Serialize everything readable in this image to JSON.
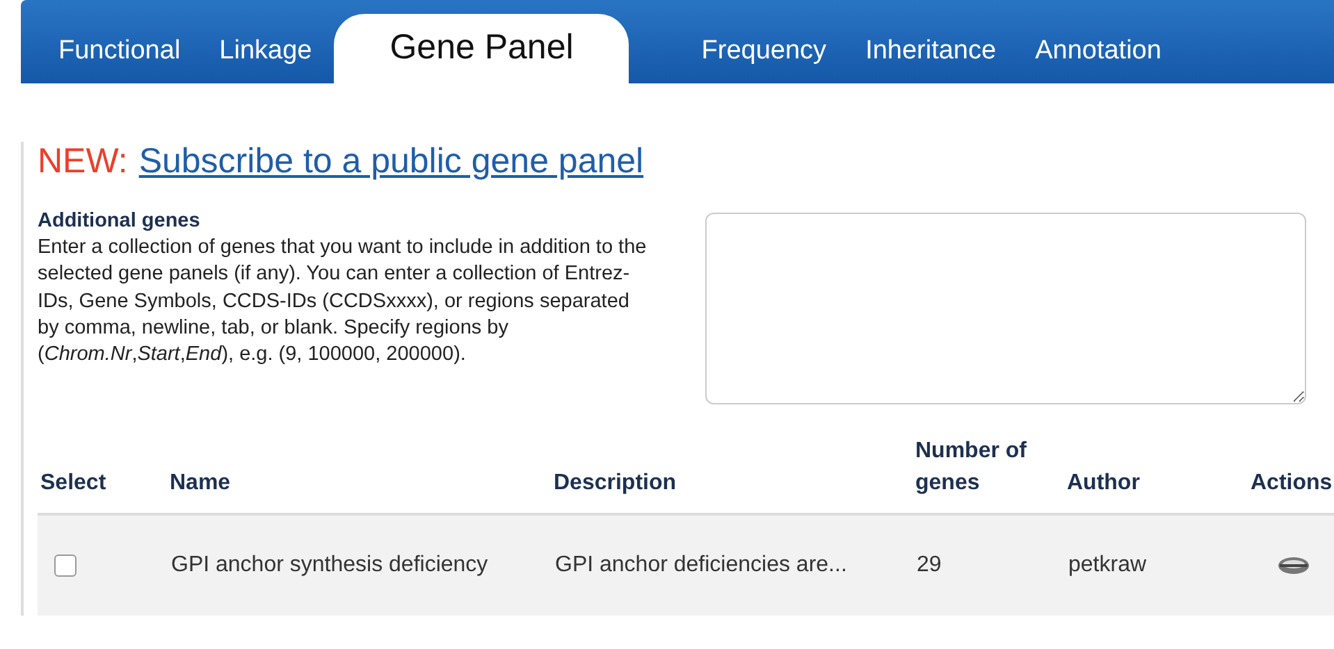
{
  "tabs": [
    {
      "label": "Functional",
      "selected": false
    },
    {
      "label": "Linkage",
      "selected": false
    },
    {
      "label": "Gene Panel",
      "selected": true
    },
    {
      "label": "Frequency",
      "selected": false
    },
    {
      "label": "Inheritance",
      "selected": false
    },
    {
      "label": "Annotation",
      "selected": false
    }
  ],
  "announcement": {
    "prefix": "NEW:",
    "link": "Subscribe to a public gene panel"
  },
  "additional_genes": {
    "title": "Additional genes",
    "description": "Enter a collection of genes that you want to include in addition to the selected gene panels (if any). You can enter a collection of Entrez-IDs, Gene Symbols, CCDS-IDs (CCDSxxxx), or regions separated by comma, newline, tab, or blank. Specify regions by (*Chrom.Nr*,*Start*,*End*), e.g. (9, 100000, 200000)."
  },
  "table": {
    "columns": [
      "Select",
      "Name",
      "Description",
      "Number of genes",
      "Author",
      "Actions"
    ],
    "rows": [
      {
        "checked": false,
        "name": "GPI anchor synthesis deficiency",
        "description": "GPI anchor deficiencies are...",
        "number_of_genes": "29",
        "author": "petkraw"
      }
    ]
  }
}
